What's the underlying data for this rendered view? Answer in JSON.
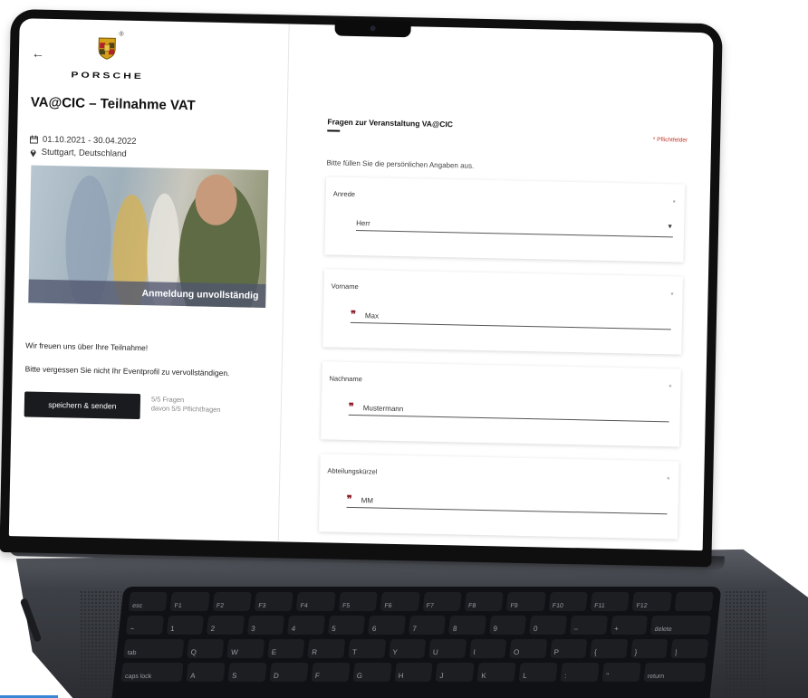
{
  "brand": {
    "wordmark": "PORSCHE",
    "registered": "®"
  },
  "event": {
    "title": "VA@CIC – Teilnahme VAT",
    "date_range": "01.10.2021 - 30.04.2022",
    "location": "Stuttgart, Deutschland",
    "image_status": "Anmeldung unvollständig",
    "welcome_text": "Wir freuen uns über Ihre Teilnahme!",
    "reminder_text": "Bitte vergessen Sie nicht Ihr Eventprofil zu vervollständigen.",
    "submit_label": "speichern & senden",
    "progress_questions": "5/5 Fragen",
    "progress_required": "davon 5/5 Pflichtfragen"
  },
  "form": {
    "section_title": "Fragen zur Veranstaltung VA@CIC",
    "required_note": "* Pflichtfelder",
    "intro": "Bitte füllen Sie die persönlichen Angaben aus.",
    "required_marker": "*",
    "fields": [
      {
        "label": "Anrede",
        "value": "Herr",
        "type": "select"
      },
      {
        "label": "Vorname",
        "value": "Max",
        "type": "text"
      },
      {
        "label": "Nachname",
        "value": "Mustermann",
        "type": "text"
      },
      {
        "label": "Abteilungskürzel",
        "value": "MM",
        "type": "text"
      }
    ]
  },
  "keyboard": {
    "row1": [
      "esc",
      "F1",
      "F2",
      "F3",
      "F4",
      "F5",
      "F6",
      "F7",
      "F8",
      "F9",
      "F10",
      "F11",
      "F12",
      ""
    ],
    "row2": [
      "~",
      "1",
      "2",
      "3",
      "4",
      "5",
      "6",
      "7",
      "8",
      "9",
      "0",
      "–",
      "+",
      "delete"
    ],
    "row3": [
      "tab",
      "Q",
      "W",
      "E",
      "R",
      "T",
      "Y",
      "U",
      "I",
      "O",
      "P",
      "{",
      "}",
      "|"
    ],
    "row4": [
      "caps lock",
      "A",
      "S",
      "D",
      "F",
      "G",
      "H",
      "J",
      "K",
      "L",
      ":",
      "\"",
      "return"
    ]
  },
  "colors": {
    "accent_red": "#8b1e2b",
    "button_dark": "#1a1b1f",
    "status_overlay": "#50566e"
  },
  "icons": {
    "back": "arrow-left-icon",
    "calendar": "calendar-icon",
    "location": "location-pin-icon",
    "quote": "quote-icon",
    "select": "chevron-down-icon"
  }
}
